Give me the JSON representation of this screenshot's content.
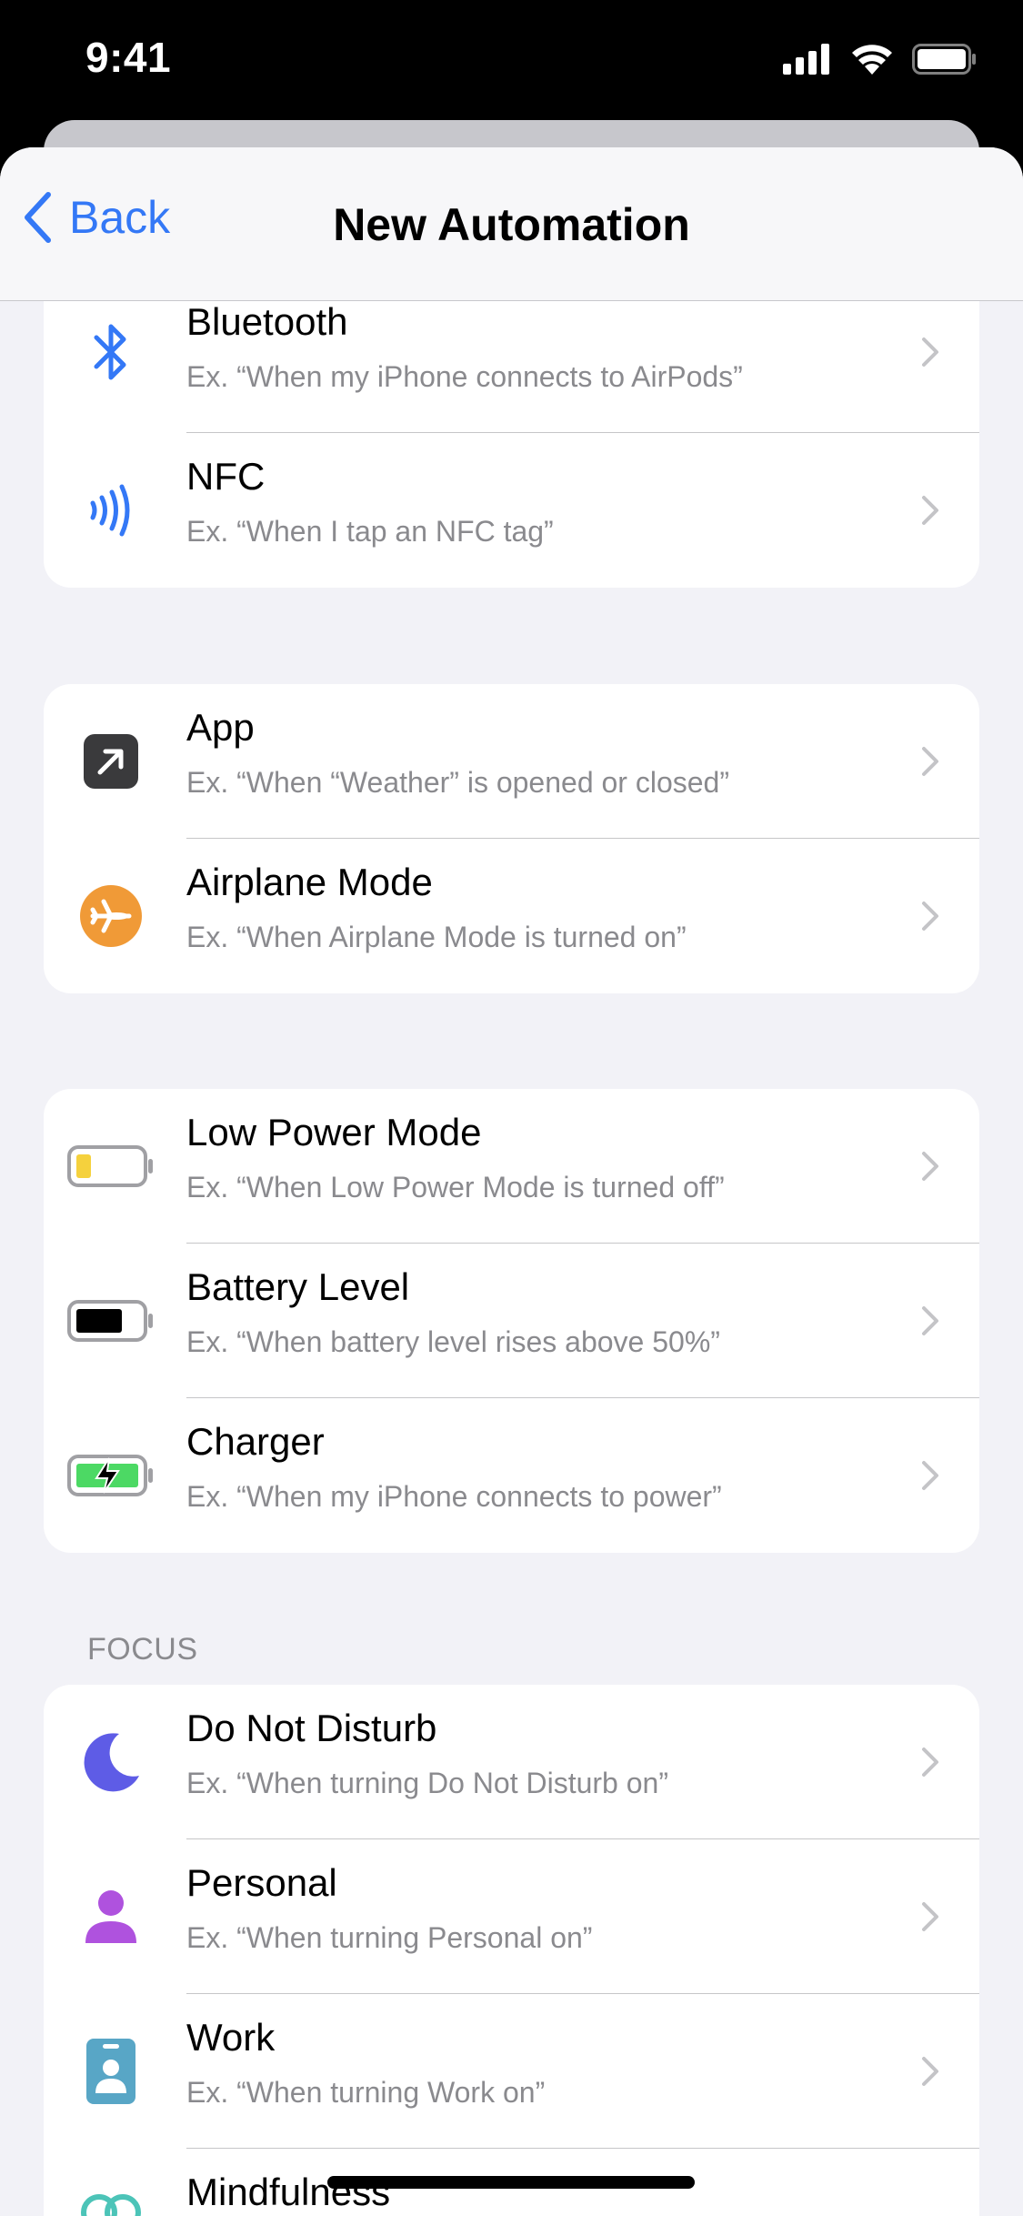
{
  "status_bar": {
    "time": "9:41"
  },
  "nav": {
    "back_label": "Back",
    "title": "New Automation"
  },
  "groups": {
    "connectivity": [
      {
        "title": "Bluetooth",
        "subtitle": "Ex. “When my iPhone connects to AirPods”",
        "icon": "bluetooth-icon"
      },
      {
        "title": "NFC",
        "subtitle": "Ex. “When I tap an NFC tag”",
        "icon": "nfc-icon"
      }
    ],
    "apps": [
      {
        "title": "App",
        "subtitle": "Ex. “When “Weather” is opened or closed”",
        "icon": "app-arrow-icon"
      },
      {
        "title": "Airplane Mode",
        "subtitle": "Ex. “When Airplane Mode is turned on”",
        "icon": "airplane-icon"
      }
    ],
    "power": [
      {
        "title": "Low Power Mode",
        "subtitle": "Ex. “When Low Power Mode is turned off”",
        "icon": "low-battery-icon"
      },
      {
        "title": "Battery Level",
        "subtitle": "Ex. “When battery level rises above 50%”",
        "icon": "battery-icon"
      },
      {
        "title": "Charger",
        "subtitle": "Ex. “When my iPhone connects to power”",
        "icon": "charging-battery-icon"
      }
    ],
    "focus_header": "FOCUS",
    "focus": [
      {
        "title": "Do Not Disturb",
        "subtitle": "Ex. “When turning Do Not Disturb on”",
        "icon": "moon-icon"
      },
      {
        "title": "Personal",
        "subtitle": "Ex. “When turning Personal on”",
        "icon": "person-icon"
      },
      {
        "title": "Work",
        "subtitle": "Ex. “When turning Work on”",
        "icon": "id-badge-icon"
      },
      {
        "title": "Mindfulness",
        "subtitle": "",
        "icon": "mindfulness-icon"
      }
    ]
  },
  "colors": {
    "accent": "#3478f6",
    "airplane": "#f09a37",
    "low_power": "#f5d13d",
    "charging": "#4cd964",
    "moon": "#5e5ce6",
    "person": "#af52de",
    "work": "#58a6c6",
    "mindfulness": "#4cc4b8"
  }
}
